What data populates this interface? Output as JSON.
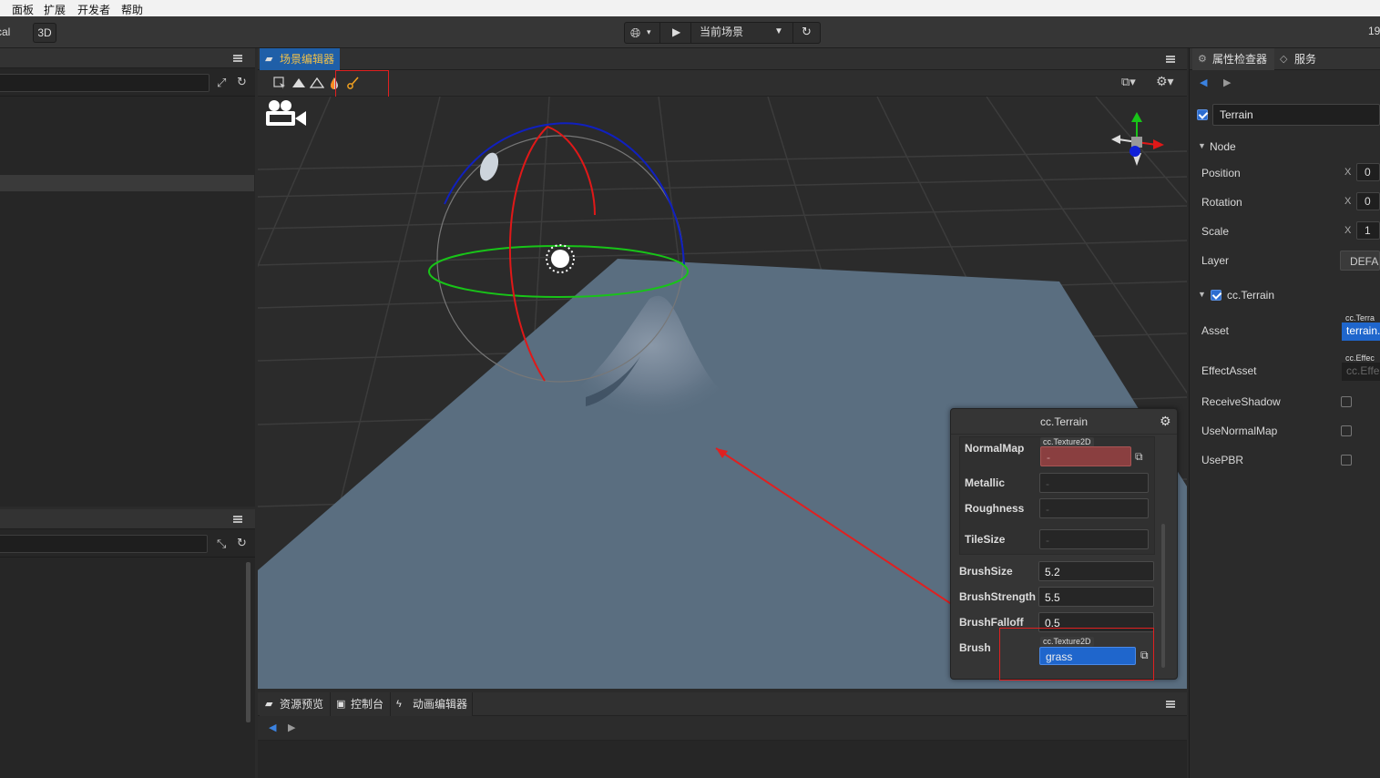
{
  "menubar": {
    "items": [
      "面板",
      "扩展",
      "开发者",
      "帮助"
    ]
  },
  "toolbar": {
    "left_partial_label": "cal",
    "mode_3d": "3D",
    "scene_select": "当前场景",
    "right_partial_text": "19"
  },
  "scene_editor": {
    "tab_label": "场景编辑器",
    "tools": [
      "select-icon",
      "raise-terrain-icon",
      "smooth-terrain-icon",
      "paint-drop-icon",
      "brush-icon"
    ]
  },
  "terrain_panel": {
    "title": "cc.Terrain",
    "normal_map_label": "NormalMap",
    "normal_map_type": "cc.Texture2D",
    "normal_map_value": "-",
    "metallic_label": "Metallic",
    "metallic_value": "-",
    "roughness_label": "Roughness",
    "roughness_value": "-",
    "tilesize_label": "TileSize",
    "tilesize_value": "-",
    "brush_size_label": "BrushSize",
    "brush_size_value": "5.2",
    "brush_strength_label": "BrushStrength",
    "brush_strength_value": "5.5",
    "brush_falloff_label": "BrushFalloff",
    "brush_falloff_value": "0.5",
    "brush_label": "Brush",
    "brush_type": "cc.Texture2D",
    "brush_value": "grass"
  },
  "bottom_tabs": [
    "资源预览",
    "控制台",
    "动画编辑器"
  ],
  "inspector": {
    "tabs": [
      "属性检查器",
      "服务"
    ],
    "node_name": "Terrain",
    "node_section": "Node",
    "position_label": "Position",
    "position_x": "0",
    "rotation_label": "Rotation",
    "rotation_x": "0",
    "scale_label": "Scale",
    "scale_x": "1",
    "layer_label": "Layer",
    "layer_value": "DEFAU",
    "x_axis": "X",
    "component": "cc.Terrain",
    "asset_label": "Asset",
    "asset_type": "cc.Terra",
    "asset_value": "terrain.",
    "effect_label": "EffectAsset",
    "effect_type": "cc.Effec",
    "effect_value": "cc.Effe",
    "receive_shadow": "ReceiveShadow",
    "use_normal_map": "UseNormalMap",
    "use_pbr": "UsePBR"
  },
  "colors": {
    "accent_blue": "#1f5fa8",
    "highlight_red": "#e02020",
    "ground": "#5a6e80",
    "tab_text_active": "#f0c04a"
  }
}
